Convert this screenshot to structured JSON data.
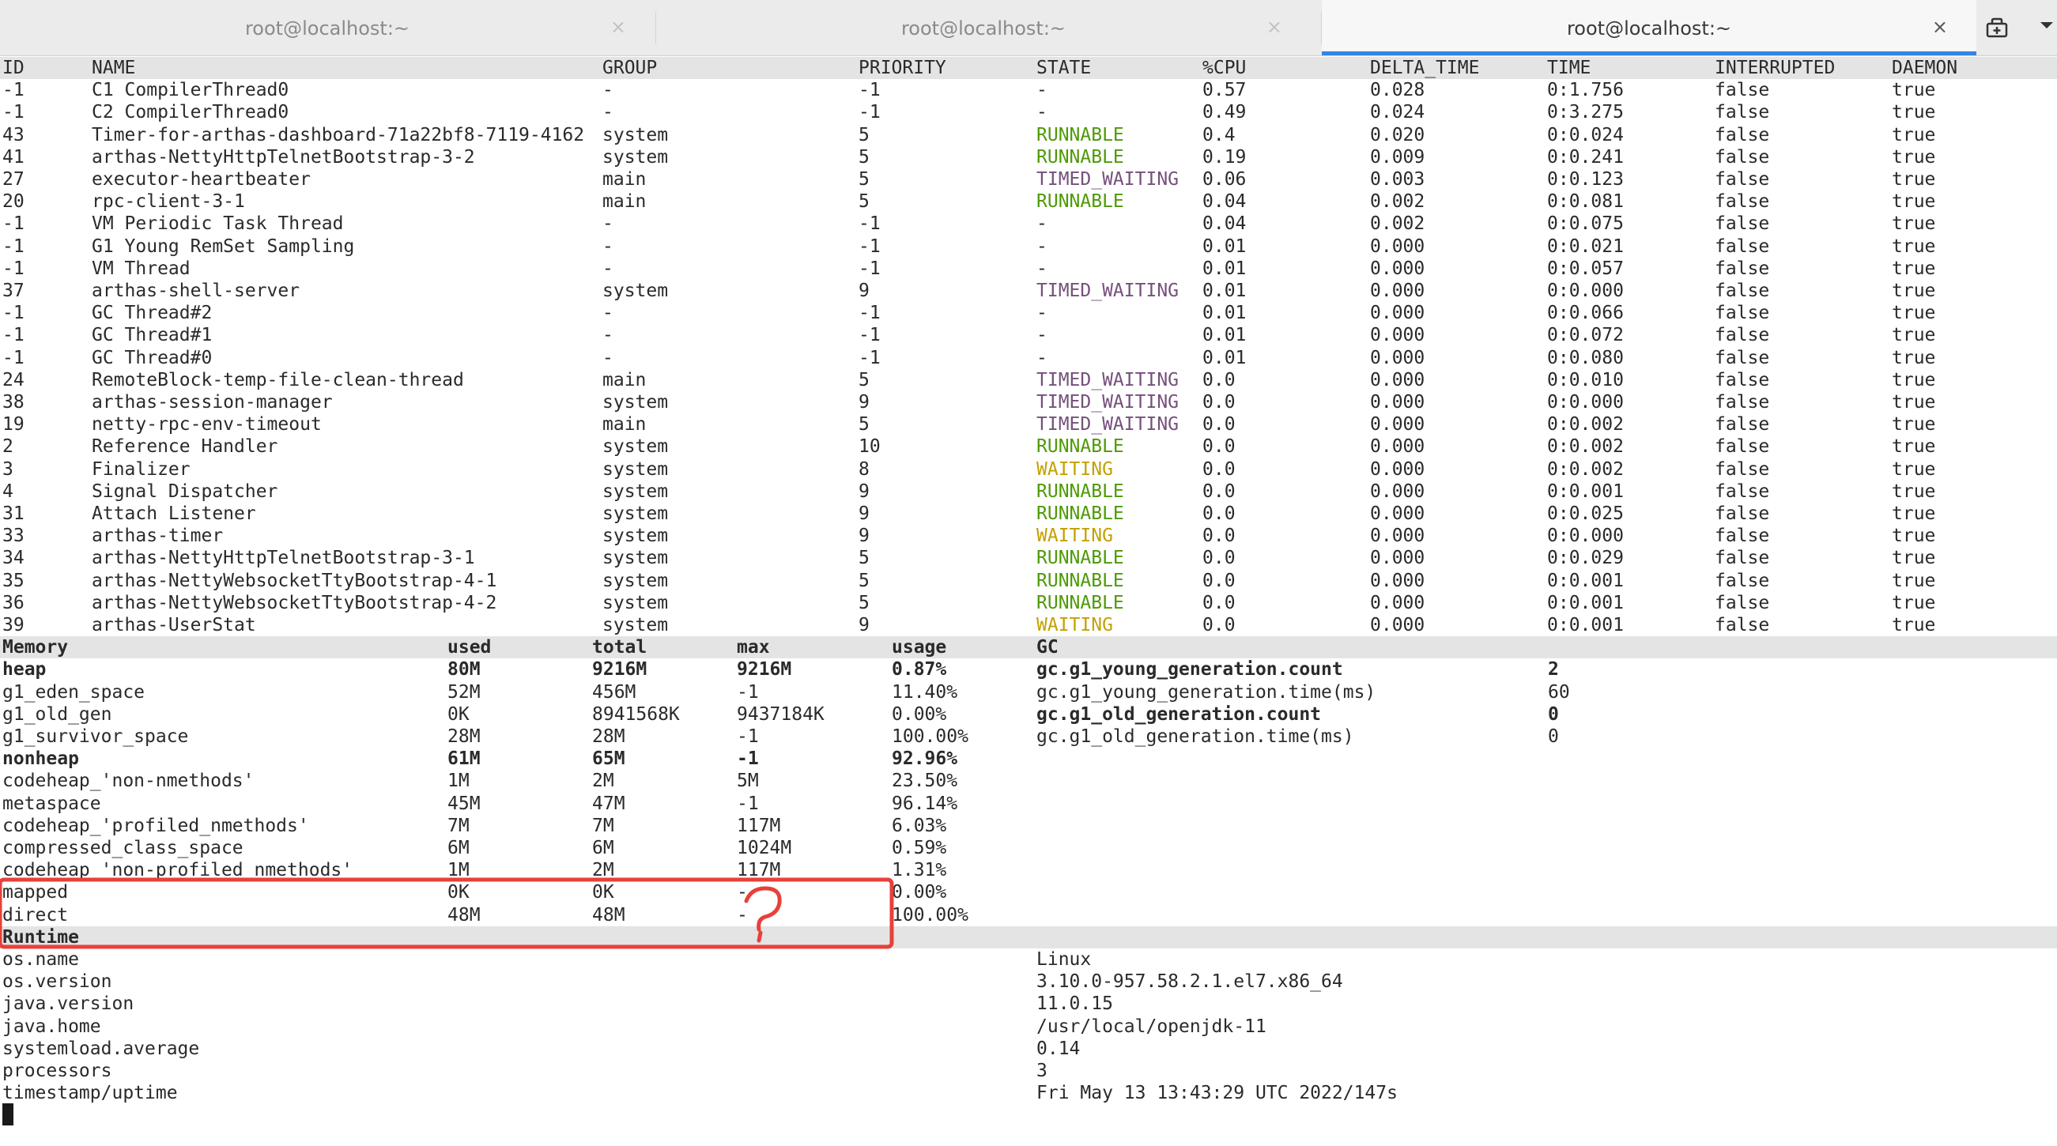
{
  "tabs": [
    {
      "label": "root@localhost:~",
      "active": false
    },
    {
      "label": "root@localhost:~",
      "active": false
    },
    {
      "label": "root@localhost:~",
      "active": true
    }
  ],
  "tab_close_glyph": "×",
  "icons": {
    "new_tab": "new-tab-icon",
    "menu": "chevron-down-icon",
    "close": "close-icon",
    "annotation": "question-mark-annotation"
  },
  "colors": {
    "runnable": "#4e9a06",
    "timed_waiting": "#75507b",
    "waiting": "#c4a000",
    "accent": "#3584e4",
    "annotation": "#e8403a"
  },
  "threads": {
    "headers": [
      "ID",
      "NAME",
      "GROUP",
      "PRIORITY",
      "STATE",
      "%CPU",
      "DELTA_TIME",
      "TIME",
      "INTERRUPTED",
      "DAEMON"
    ],
    "rows": [
      [
        "-1",
        "C1 CompilerThread0",
        "-",
        "-1",
        "-",
        "0.57",
        "0.028",
        "0:1.756",
        "false",
        "true"
      ],
      [
        "-1",
        "C2 CompilerThread0",
        "-",
        "-1",
        "-",
        "0.49",
        "0.024",
        "0:3.275",
        "false",
        "true"
      ],
      [
        "43",
        "Timer-for-arthas-dashboard-71a22bf8-7119-4162",
        "system",
        "5",
        "RUNNABLE",
        "0.4",
        "0.020",
        "0:0.024",
        "false",
        "true"
      ],
      [
        "41",
        "arthas-NettyHttpTelnetBootstrap-3-2",
        "system",
        "5",
        "RUNNABLE",
        "0.19",
        "0.009",
        "0:0.241",
        "false",
        "true"
      ],
      [
        "27",
        "executor-heartbeater",
        "main",
        "5",
        "TIMED_WAITING",
        "0.06",
        "0.003",
        "0:0.123",
        "false",
        "true"
      ],
      [
        "20",
        "rpc-client-3-1",
        "main",
        "5",
        "RUNNABLE",
        "0.04",
        "0.002",
        "0:0.081",
        "false",
        "true"
      ],
      [
        "-1",
        "VM Periodic Task Thread",
        "-",
        "-1",
        "-",
        "0.04",
        "0.002",
        "0:0.075",
        "false",
        "true"
      ],
      [
        "-1",
        "G1 Young RemSet Sampling",
        "-",
        "-1",
        "-",
        "0.01",
        "0.000",
        "0:0.021",
        "false",
        "true"
      ],
      [
        "-1",
        "VM Thread",
        "-",
        "-1",
        "-",
        "0.01",
        "0.000",
        "0:0.057",
        "false",
        "true"
      ],
      [
        "37",
        "arthas-shell-server",
        "system",
        "9",
        "TIMED_WAITING",
        "0.01",
        "0.000",
        "0:0.000",
        "false",
        "true"
      ],
      [
        "-1",
        "GC Thread#2",
        "-",
        "-1",
        "-",
        "0.01",
        "0.000",
        "0:0.066",
        "false",
        "true"
      ],
      [
        "-1",
        "GC Thread#1",
        "-",
        "-1",
        "-",
        "0.01",
        "0.000",
        "0:0.072",
        "false",
        "true"
      ],
      [
        "-1",
        "GC Thread#0",
        "-",
        "-1",
        "-",
        "0.01",
        "0.000",
        "0:0.080",
        "false",
        "true"
      ],
      [
        "24",
        "RemoteBlock-temp-file-clean-thread",
        "main",
        "5",
        "TIMED_WAITING",
        "0.0",
        "0.000",
        "0:0.010",
        "false",
        "true"
      ],
      [
        "38",
        "arthas-session-manager",
        "system",
        "9",
        "TIMED_WAITING",
        "0.0",
        "0.000",
        "0:0.000",
        "false",
        "true"
      ],
      [
        "19",
        "netty-rpc-env-timeout",
        "main",
        "5",
        "TIMED_WAITING",
        "0.0",
        "0.000",
        "0:0.002",
        "false",
        "true"
      ],
      [
        "2",
        "Reference Handler",
        "system",
        "10",
        "RUNNABLE",
        "0.0",
        "0.000",
        "0:0.002",
        "false",
        "true"
      ],
      [
        "3",
        "Finalizer",
        "system",
        "8",
        "WAITING",
        "0.0",
        "0.000",
        "0:0.002",
        "false",
        "true"
      ],
      [
        "4",
        "Signal Dispatcher",
        "system",
        "9",
        "RUNNABLE",
        "0.0",
        "0.000",
        "0:0.001",
        "false",
        "true"
      ],
      [
        "31",
        "Attach Listener",
        "system",
        "9",
        "RUNNABLE",
        "0.0",
        "0.000",
        "0:0.025",
        "false",
        "true"
      ],
      [
        "33",
        "arthas-timer",
        "system",
        "9",
        "WAITING",
        "0.0",
        "0.000",
        "0:0.000",
        "false",
        "true"
      ],
      [
        "34",
        "arthas-NettyHttpTelnetBootstrap-3-1",
        "system",
        "5",
        "RUNNABLE",
        "0.0",
        "0.000",
        "0:0.029",
        "false",
        "true"
      ],
      [
        "35",
        "arthas-NettyWebsocketTtyBootstrap-4-1",
        "system",
        "5",
        "RUNNABLE",
        "0.0",
        "0.000",
        "0:0.001",
        "false",
        "true"
      ],
      [
        "36",
        "arthas-NettyWebsocketTtyBootstrap-4-2",
        "system",
        "5",
        "RUNNABLE",
        "0.0",
        "0.000",
        "0:0.001",
        "false",
        "true"
      ],
      [
        "39",
        "arthas-UserStat",
        "system",
        "9",
        "WAITING",
        "0.0",
        "0.000",
        "0:0.001",
        "false",
        "true"
      ]
    ]
  },
  "memory": {
    "headers": [
      "Memory",
      "used",
      "total",
      "max",
      "usage",
      "GC"
    ],
    "rows": [
      {
        "cells": [
          "heap",
          "80M",
          "9216M",
          "9216M",
          "0.87%"
        ],
        "bold": true
      },
      {
        "cells": [
          "g1_eden_space",
          "52M",
          "456M",
          "-1",
          "11.40%"
        ],
        "bold": false
      },
      {
        "cells": [
          "g1_old_gen",
          "0K",
          "8941568K",
          "9437184K",
          "0.00%"
        ],
        "bold": false
      },
      {
        "cells": [
          "g1_survivor_space",
          "28M",
          "28M",
          "-1",
          "100.00%"
        ],
        "bold": false
      },
      {
        "cells": [
          "nonheap",
          "61M",
          "65M",
          "-1",
          "92.96%"
        ],
        "bold": true
      },
      {
        "cells": [
          "codeheap_'non-nmethods'",
          "1M",
          "2M",
          "5M",
          "23.50%"
        ],
        "bold": false
      },
      {
        "cells": [
          "metaspace",
          "45M",
          "47M",
          "-1",
          "96.14%"
        ],
        "bold": false
      },
      {
        "cells": [
          "codeheap_'profiled_nmethods'",
          "7M",
          "7M",
          "117M",
          "6.03%"
        ],
        "bold": false
      },
      {
        "cells": [
          "compressed_class_space",
          "6M",
          "6M",
          "1024M",
          "0.59%"
        ],
        "bold": false
      },
      {
        "cells": [
          "codeheap_'non-profiled_nmethods'",
          "1M",
          "2M",
          "117M",
          "1.31%"
        ],
        "bold": false
      },
      {
        "cells": [
          "mapped",
          "0K",
          "0K",
          "-",
          "0.00%"
        ],
        "bold": false
      },
      {
        "cells": [
          "direct",
          "48M",
          "48M",
          "-",
          "100.00%"
        ],
        "bold": false
      }
    ],
    "gc": [
      {
        "name": "gc.g1_young_generation.count",
        "value": "2",
        "bold": true
      },
      {
        "name": "gc.g1_young_generation.time(ms)",
        "value": "60",
        "bold": false
      },
      {
        "name": "gc.g1_old_generation.count",
        "value": "0",
        "bold": true
      },
      {
        "name": "gc.g1_old_generation.time(ms)",
        "value": "0",
        "bold": false
      }
    ]
  },
  "runtime": {
    "header": "Runtime",
    "rows": [
      [
        "os.name",
        "Linux"
      ],
      [
        "os.version",
        "3.10.0-957.58.2.1.el7.x86_64"
      ],
      [
        "java.version",
        "11.0.15"
      ],
      [
        "java.home",
        "/usr/local/openjdk-11"
      ],
      [
        "systemload.average",
        "0.14"
      ],
      [
        "processors",
        "3"
      ],
      [
        "timestamp/uptime",
        "Fri May 13 13:43:29 UTC 2022/147s"
      ]
    ]
  }
}
